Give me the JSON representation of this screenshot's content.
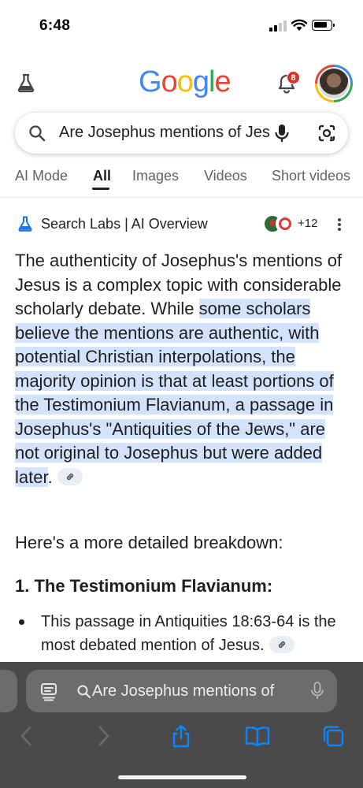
{
  "status_bar": {
    "time": "6:48"
  },
  "header": {
    "logo": [
      "G",
      "o",
      "o",
      "g",
      "l",
      "e"
    ],
    "logo_colors": [
      "#4285F4",
      "#EA4335",
      "#FBBC05",
      "#4285F4",
      "#34A853",
      "#EA4335"
    ],
    "notification_count": "8"
  },
  "search": {
    "query": "Are Josephus mentions of Jesus authentic?"
  },
  "tabs": [
    "AI Mode",
    "All",
    "Images",
    "Videos",
    "Short videos"
  ],
  "active_tab": "All",
  "ai_overview": {
    "title": "Search Labs | AI Overview",
    "source_count": "+12",
    "intro": "The authenticity of Josephus's mentions of Jesus is a complex topic with considerable scholarly debate. While ",
    "highlight": "some scholars believe the mentions are authentic, with potential Christian interpolations, the majority opinion is that at least portions of the Testimonium Flavianum, a passage in Josephus's \"Antiquities of the Jews,\" are not original to Josephus but were added later",
    "after": ".",
    "breakdown": "Here's a more detailed breakdown:",
    "section1": "1. The Testimonium Flavianum:",
    "bullet1": "This passage in Antiquities 18:63-64 is the most debated mention of Jesus."
  },
  "safari": {
    "url_text": "Are Josephus mentions of"
  },
  "colors": {
    "highlight": "#d3e3fd",
    "toolbar_blue": "#0a84ff",
    "toolbar_bg": "#4a4a4a"
  }
}
